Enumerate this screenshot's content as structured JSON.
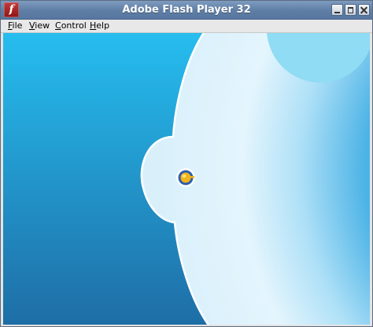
{
  "window": {
    "title": "Adobe Flash Player 32",
    "app_icon_glyph": "f",
    "controls": [
      "minimize-icon",
      "maximize-icon",
      "close-icon"
    ]
  },
  "menubar": {
    "items": [
      {
        "label": "File",
        "mnemonic": "F",
        "rest": "ile"
      },
      {
        "label": "View",
        "mnemonic": "V",
        "rest": "iew"
      },
      {
        "label": "Control",
        "mnemonic": "C",
        "rest": "ontrol"
      },
      {
        "label": "Help",
        "mnemonic": "H",
        "rest": "elp"
      }
    ]
  },
  "stage": {
    "colors": {
      "sky_top": "#26bdef",
      "sky_bottom": "#1e6ea6",
      "planet_light": "#e4f5fd",
      "planet_shadow": "#4cb3e6",
      "moon": "#8fdcf4",
      "outline": "#ffffff",
      "ship_ring": "#2c5fb0",
      "ship_body": "#f2b418"
    }
  }
}
